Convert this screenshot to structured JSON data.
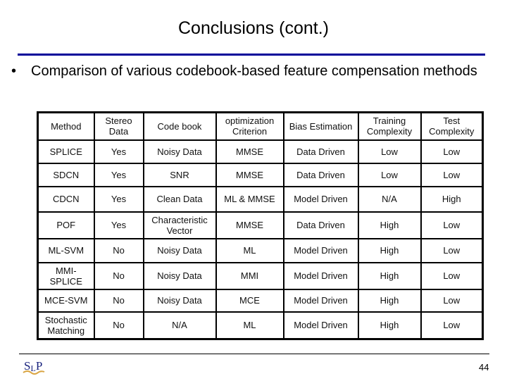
{
  "slide": {
    "title": "Conclusions (cont.)",
    "bullet_symbol": "•",
    "bullet_text": "Comparison of various codebook-based feature compensation methods",
    "page_number": "44",
    "logo_text": "SLP",
    "colors": {
      "title_rule": "#000099",
      "logo_blue": "#1a237e",
      "logo_gold": "#d9a441"
    }
  },
  "table": {
    "headers": [
      "Method",
      "Stereo Data",
      "Code book",
      "optimization Criterion",
      "Bias Estimation",
      "Training Complexity",
      "Test Complexity"
    ],
    "rows": [
      [
        "SPLICE",
        "Yes",
        "Noisy Data",
        "MMSE",
        "Data Driven",
        "Low",
        "Low"
      ],
      [
        "SDCN",
        "Yes",
        "SNR",
        "MMSE",
        "Data Driven",
        "Low",
        "Low"
      ],
      [
        "CDCN",
        "Yes",
        "Clean Data",
        "ML & MMSE",
        "Model Driven",
        "N/A",
        "High"
      ],
      [
        "POF",
        "Yes",
        "Characteristic Vector",
        "MMSE",
        "Data Driven",
        "High",
        "Low"
      ],
      [
        "ML-SVM",
        "No",
        "Noisy Data",
        "ML",
        "Model Driven",
        "High",
        "Low"
      ],
      [
        "MMI-SPLICE",
        "No",
        "Noisy Data",
        "MMI",
        "Model Driven",
        "High",
        "Low"
      ],
      [
        "MCE-SVM",
        "No",
        "Noisy Data",
        "MCE",
        "Model Driven",
        "High",
        "Low"
      ],
      [
        "Stochastic Matching",
        "No",
        "N/A",
        "ML",
        "Model Driven",
        "High",
        "Low"
      ]
    ]
  }
}
